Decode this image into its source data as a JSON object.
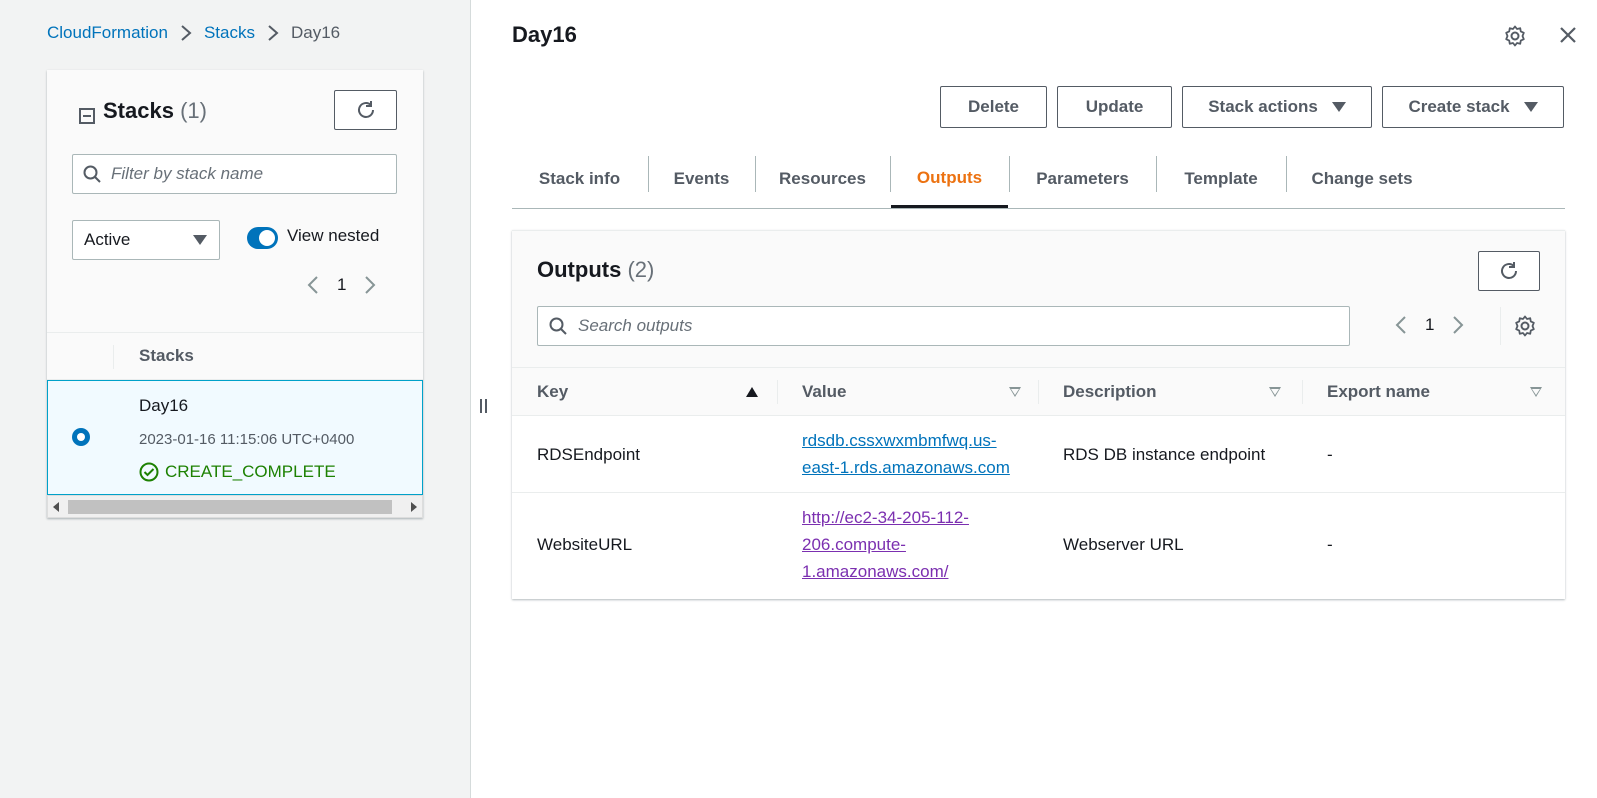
{
  "breadcrumb": {
    "items": [
      "CloudFormation",
      "Stacks"
    ],
    "current": "Day16",
    "separator": ">"
  },
  "stacks_panel": {
    "title": "Stacks",
    "count": "(1)",
    "filter_placeholder": "Filter by stack name",
    "status_filter": "Active",
    "view_nested_label": "View nested",
    "view_nested_on": true,
    "page": "1",
    "column_header": "Stacks",
    "rows": [
      {
        "name": "Day16",
        "created": "2023-01-16 11:15:06 UTC+0400",
        "status": "CREATE_COMPLETE",
        "selected": true
      }
    ]
  },
  "detail": {
    "title": "Day16",
    "buttons": {
      "delete": "Delete",
      "update": "Update",
      "stack_actions": "Stack actions",
      "create_stack": "Create stack"
    },
    "tabs": [
      "Stack info",
      "Events",
      "Resources",
      "Outputs",
      "Parameters",
      "Template",
      "Change sets"
    ],
    "active_tab": "Outputs"
  },
  "outputs": {
    "title": "Outputs",
    "count": "(2)",
    "search_placeholder": "Search outputs",
    "page": "1",
    "columns": [
      "Key",
      "Value",
      "Description",
      "Export name"
    ],
    "rows": [
      {
        "key": "RDSEndpoint",
        "value_lines": [
          "rdsdb.cssxwxmbmfwq.us-",
          "east-1.rds.amazonaws.com"
        ],
        "description": "RDS DB instance endpoint",
        "export_name": "-"
      },
      {
        "key": "WebsiteURL",
        "value_lines": [
          "http://ec2-34-205-112-",
          "206.compute-",
          "1.amazonaws.com/"
        ],
        "description": "Webserver URL",
        "export_name": "-"
      }
    ]
  },
  "colors": {
    "link": "#0073bb",
    "visited_link": "#7b2fb0",
    "active_tab": "#ec7211",
    "success": "#1d8102",
    "selected_row_bg": "#f1faff",
    "selected_row_border": "#00a1c9"
  },
  "icons": [
    "refresh-icon",
    "search-icon",
    "chevron-left-icon",
    "chevron-right-icon",
    "success-icon",
    "settings-icon",
    "close-icon",
    "collapse-icon",
    "caret-down-icon",
    "sort-ascending-icon",
    "sort-icon"
  ]
}
